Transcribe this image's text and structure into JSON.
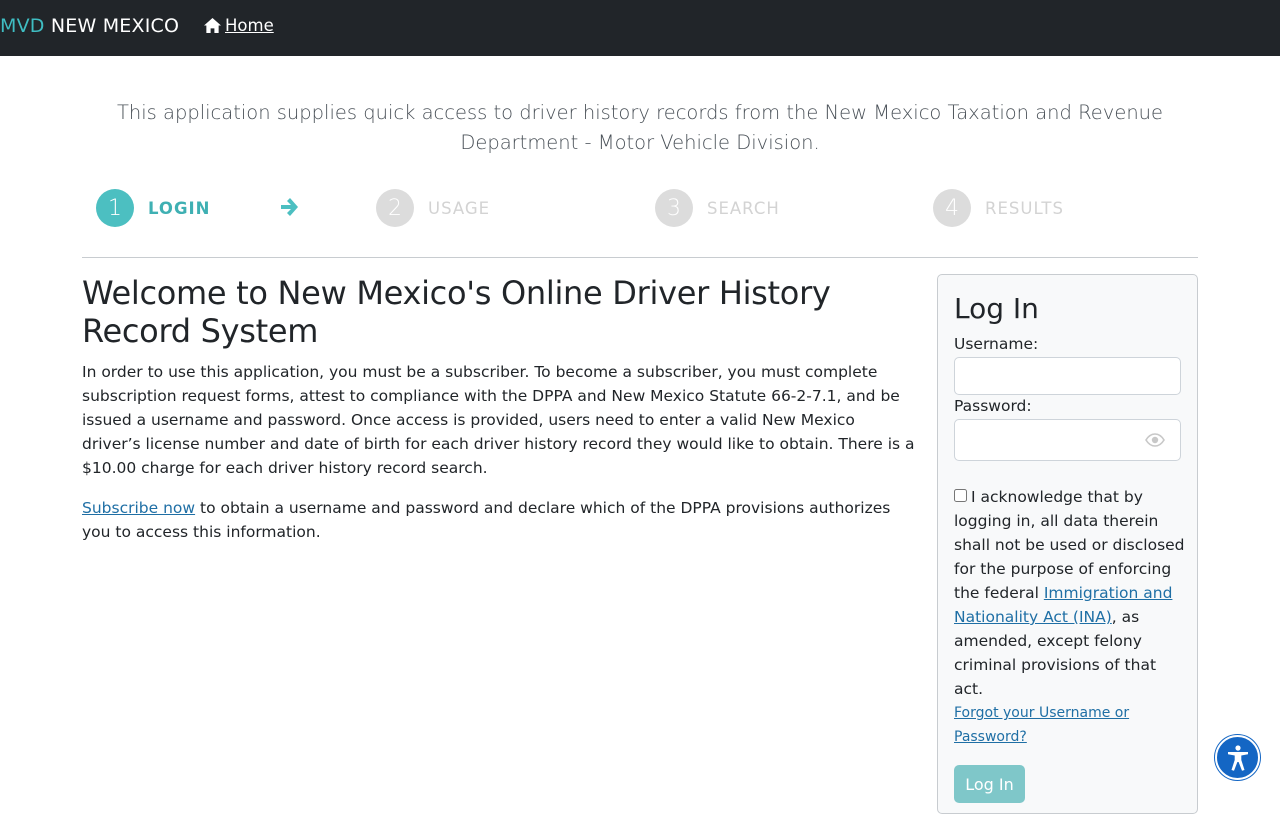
{
  "navbar": {
    "brand_prefix": "MVD",
    "brand_suffix": "NEW MEXICO",
    "home_label": "Home",
    "accent_color": "#3fbdc2",
    "background_color": "#212529"
  },
  "intro": "This application supplies quick access to driver history records from the New Mexico Taxation and Revenue Department - Motor Vehicle Division.",
  "steps": [
    {
      "number": "1",
      "label": "LOGIN",
      "state": "active"
    },
    {
      "number": "2",
      "label": "USAGE",
      "state": "inactive"
    },
    {
      "number": "3",
      "label": "SEARCH",
      "state": "inactive"
    },
    {
      "number": "4",
      "label": "RESULTS",
      "state": "inactive"
    }
  ],
  "main": {
    "title": "Welcome to New Mexico's Online Driver History Record System",
    "description": "In order to use this application, you must be a subscriber. To become a subscriber, you must complete subscription request forms, attest to compliance with the DPPA and New Mexico Statute 66-2-7.1, and be issued a username and password. Once access is provided, users need to enter a valid New Mexico driver’s license number and date of birth for each driver history record they would like to obtain. There is a $10.00 charge for each driver history record search.",
    "subscribe_link": "Subscribe now",
    "subscribe_rest": " to obtain a username and password and declare which of the DPPA provisions authorizes you to access this information."
  },
  "login": {
    "title": "Log In",
    "username_label": "Username:",
    "username_value": "",
    "password_label": "Password:",
    "password_value": "",
    "ack_checked": false,
    "ack_text_before": "I acknowledge that by logging in, all data therein shall not be used or disclosed for the purpose of enforcing the federal ",
    "ack_link": "Immigration and Nationality Act (INA)",
    "ack_text_after": ", as amended, except felony criminal provisions of that act.",
    "forgot_link": "Forgot your Username or Password?",
    "button_label": "Log In",
    "button_color": "#7fc7c9"
  },
  "icons": {
    "home": "home-icon",
    "step_arrow": "arrow-right-icon",
    "show_password": "eye-icon",
    "accessibility": "accessibility-icon"
  }
}
